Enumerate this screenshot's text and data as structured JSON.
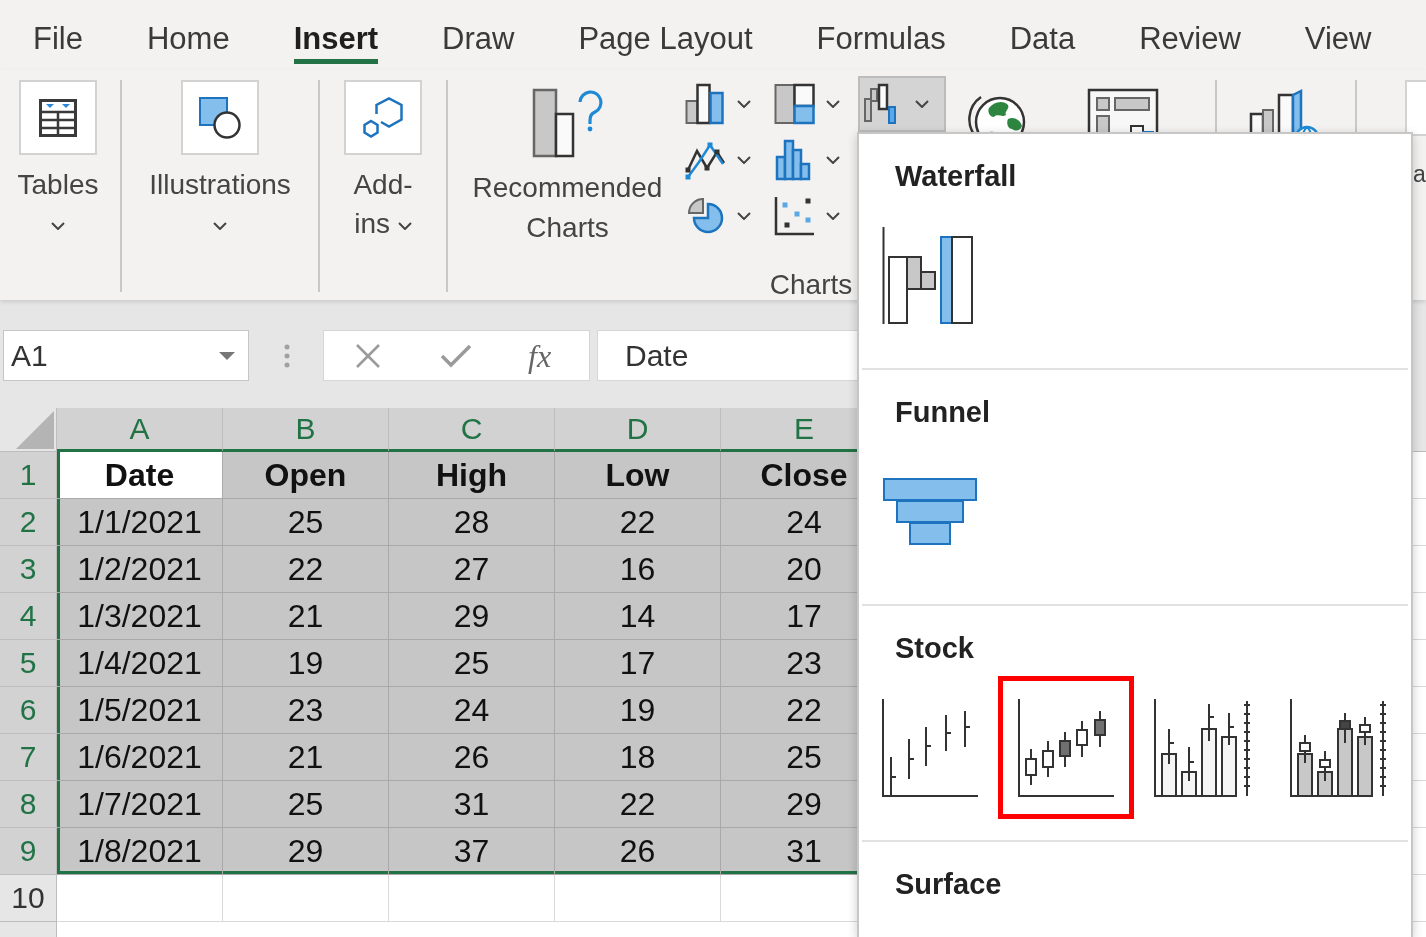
{
  "menu_tabs": [
    {
      "label": "File",
      "selected": false
    },
    {
      "label": "Home",
      "selected": false
    },
    {
      "label": "Insert",
      "selected": true
    },
    {
      "label": "Draw",
      "selected": false
    },
    {
      "label": "Page Layout",
      "selected": false
    },
    {
      "label": "Formulas",
      "selected": false
    },
    {
      "label": "Data",
      "selected": false
    },
    {
      "label": "Review",
      "selected": false
    },
    {
      "label": "View",
      "selected": false
    }
  ],
  "ribbon": {
    "large_buttons": [
      {
        "kind": "table",
        "label": "Tables"
      },
      {
        "kind": "shapes",
        "label": "Illustrations"
      },
      {
        "kind": "addins",
        "label": "Add-ins"
      }
    ],
    "charts_group": {
      "label": "Charts",
      "recommended_label": "Recommended Charts",
      "chart_buttons": [
        {
          "kind": "column",
          "expanded": false
        },
        {
          "kind": "line",
          "expanded": false
        },
        {
          "kind": "pie",
          "expanded": false
        },
        {
          "kind": "hierarchy",
          "expanded": false
        },
        {
          "kind": "statistic",
          "expanded": false
        },
        {
          "kind": "scatter",
          "expanded": false
        },
        {
          "kind": "waterfall",
          "expanded": true
        }
      ],
      "icon_buttons": [
        {
          "kind": "globe"
        },
        {
          "kind": "pivot"
        }
      ]
    },
    "tours_button": {
      "kind": "map3d"
    },
    "next_group_label": "a"
  },
  "formula_bar": {
    "name_box": "A1",
    "function_label": "fx",
    "value": "Date"
  },
  "sheet": {
    "columns": [
      {
        "label": "A",
        "selected": true
      },
      {
        "label": "B",
        "selected": true
      },
      {
        "label": "C",
        "selected": true
      },
      {
        "label": "D",
        "selected": true
      },
      {
        "label": "E",
        "selected": true
      }
    ],
    "rows": [
      {
        "header": "1",
        "selected": true,
        "kind": "header",
        "cells": [
          {
            "value": "Date",
            "active": true
          },
          {
            "value": "Open",
            "active": false
          },
          {
            "value": "High",
            "active": false
          },
          {
            "value": "Low",
            "active": false
          },
          {
            "value": "Close",
            "active": false
          }
        ]
      },
      {
        "header": "2",
        "selected": true,
        "kind": "data",
        "cells": [
          {
            "value": "1/1/2021",
            "active": false
          },
          {
            "value": "25",
            "active": false
          },
          {
            "value": "28",
            "active": false
          },
          {
            "value": "22",
            "active": false
          },
          {
            "value": "24",
            "active": false
          }
        ]
      },
      {
        "header": "3",
        "selected": true,
        "kind": "data",
        "cells": [
          {
            "value": "1/2/2021",
            "active": false
          },
          {
            "value": "22",
            "active": false
          },
          {
            "value": "27",
            "active": false
          },
          {
            "value": "16",
            "active": false
          },
          {
            "value": "20",
            "active": false
          }
        ]
      },
      {
        "header": "4",
        "selected": true,
        "kind": "data",
        "cells": [
          {
            "value": "1/3/2021",
            "active": false
          },
          {
            "value": "21",
            "active": false
          },
          {
            "value": "29",
            "active": false
          },
          {
            "value": "14",
            "active": false
          },
          {
            "value": "17",
            "active": false
          }
        ]
      },
      {
        "header": "5",
        "selected": true,
        "kind": "data",
        "cells": [
          {
            "value": "1/4/2021",
            "active": false
          },
          {
            "value": "19",
            "active": false
          },
          {
            "value": "25",
            "active": false
          },
          {
            "value": "17",
            "active": false
          },
          {
            "value": "23",
            "active": false
          }
        ]
      },
      {
        "header": "6",
        "selected": true,
        "kind": "data",
        "cells": [
          {
            "value": "1/5/2021",
            "active": false
          },
          {
            "value": "23",
            "active": false
          },
          {
            "value": "24",
            "active": false
          },
          {
            "value": "19",
            "active": false
          },
          {
            "value": "22",
            "active": false
          }
        ]
      },
      {
        "header": "7",
        "selected": true,
        "kind": "data",
        "cells": [
          {
            "value": "1/6/2021",
            "active": false
          },
          {
            "value": "21",
            "active": false
          },
          {
            "value": "26",
            "active": false
          },
          {
            "value": "18",
            "active": false
          },
          {
            "value": "25",
            "active": false
          }
        ]
      },
      {
        "header": "8",
        "selected": true,
        "kind": "data",
        "cells": [
          {
            "value": "1/7/2021",
            "active": false
          },
          {
            "value": "25",
            "active": false
          },
          {
            "value": "31",
            "active": false
          },
          {
            "value": "22",
            "active": false
          },
          {
            "value": "29",
            "active": false
          }
        ]
      },
      {
        "header": "9",
        "selected": true,
        "kind": "data",
        "cells": [
          {
            "value": "1/8/2021",
            "active": false
          },
          {
            "value": "29",
            "active": false
          },
          {
            "value": "37",
            "active": false
          },
          {
            "value": "26",
            "active": false
          },
          {
            "value": "31",
            "active": false
          }
        ]
      },
      {
        "header": "10",
        "selected": false,
        "kind": "data"
      }
    ]
  },
  "chart_menu": {
    "sections": [
      {
        "title": "Waterfall",
        "options": [
          {
            "kind": "waterfall",
            "selected": false
          }
        ]
      },
      {
        "title": "Funnel",
        "options": [
          {
            "kind": "funnel",
            "selected": false
          }
        ]
      },
      {
        "title": "Stock",
        "options": [
          {
            "kind": "high_low_close",
            "selected": false
          },
          {
            "kind": "open_high_low_close",
            "selected": true
          },
          {
            "kind": "volume_high_low_close",
            "selected": false
          },
          {
            "kind": "volume_open_high_low_close",
            "selected": false
          }
        ]
      },
      {
        "title": "Surface"
      }
    ]
  }
}
